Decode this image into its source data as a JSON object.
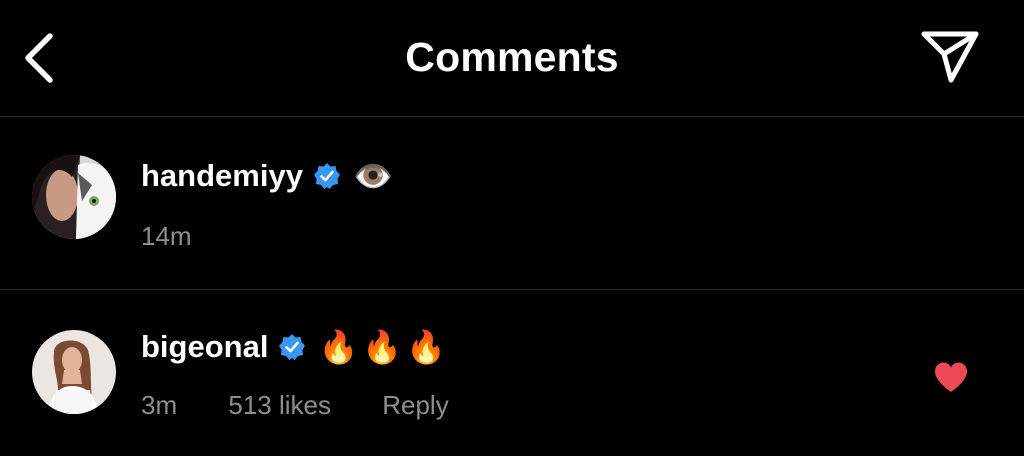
{
  "header": {
    "title": "Comments",
    "back_icon": "chevron-left-icon",
    "share_icon": "send-icon"
  },
  "comments": [
    {
      "username": "handemiyy",
      "verified": true,
      "text": "👁️",
      "time": "14m"
    },
    {
      "username": "bigeonal",
      "verified": true,
      "text": "🔥🔥🔥",
      "time": "3m",
      "likes": "513 likes",
      "reply": "Reply",
      "liked": true
    }
  ],
  "colors": {
    "background": "#000000",
    "verified_badge": "#3897f0",
    "heart": "#ed4956",
    "meta_text": "#8e8e8e",
    "divider": "#262626"
  }
}
